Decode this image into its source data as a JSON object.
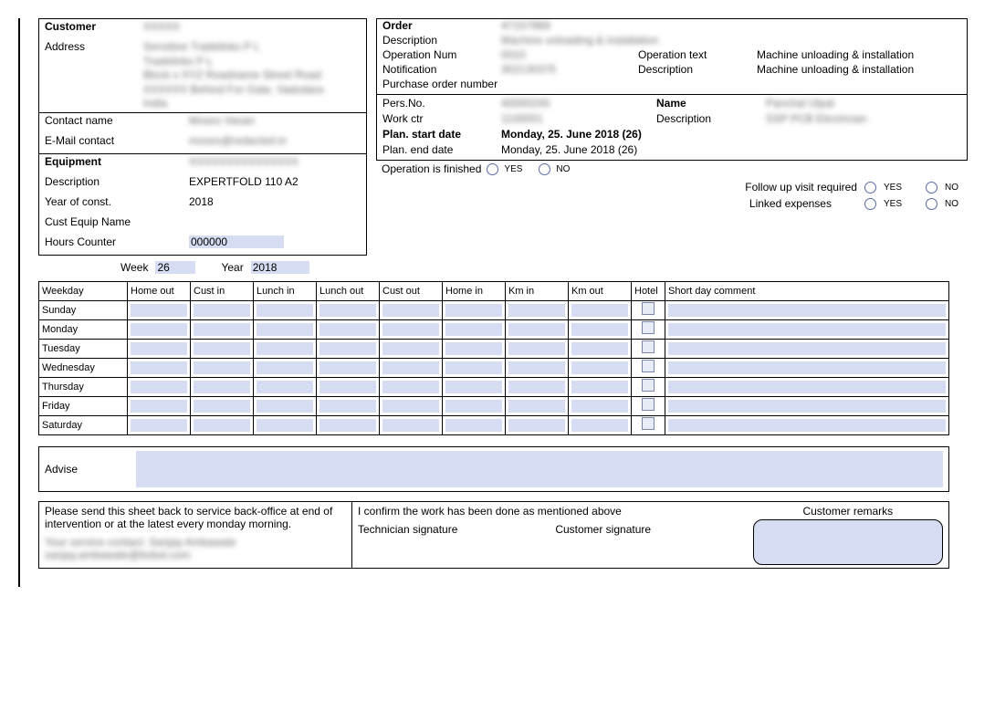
{
  "customer": {
    "label": "Customer",
    "name": "XXXXX",
    "address_label": "Address",
    "address": "Sensitive Tradelinks P L\nTradelinks P L\nBlock x XYZ Roadname Street Road\nXXXXXX Behind For Gate, Vadodara\nIndia",
    "contact_name_label": "Contact name",
    "contact_name": "Moses Vasan",
    "email_label": "E-Mail contact",
    "email": "moses@redacted.in"
  },
  "equipment": {
    "label": "Equipment",
    "value": "XXXXXXXXXXXXXXX",
    "description_label": "Description",
    "description": "EXPERTFOLD 110 A2",
    "year_label": "Year of const.",
    "year": "2018",
    "cust_equip_label": "Cust Equip Name",
    "cust_equip": "",
    "hours_label": "Hours Counter",
    "hours": "000000"
  },
  "week_label": "Week",
  "week_value": "26",
  "year_label": "Year",
  "year_value": "2018",
  "order": {
    "order_label": "Order",
    "order_val": "47157989",
    "description_label": "Description",
    "description_val": "Machine unloading & installation",
    "opnum_label": "Operation Num",
    "opnum_val": "0010",
    "optext_label": "Operation text",
    "optext_val": "Machine unloading & installation",
    "notif_label": "Notification",
    "notif_val": "302130375",
    "desc2_label": "Description",
    "desc2_val": "Machine unloading & installation",
    "po_label": "Purchase order number",
    "po_val": ""
  },
  "pers": {
    "persno_label": "Pers.No.",
    "persno_val": "40000245",
    "name_label": "Name",
    "name_val": "Panchal Utpal",
    "workctr_label": "Work ctr",
    "workctr_val": "1100001",
    "desc_label": "Description",
    "desc_val": "SSP PCB Electrician",
    "planstart_label": "Plan. start date",
    "planstart_val": "Monday, 25. June 2018 (26)",
    "planend_label": "Plan. end date",
    "planend_val": "Monday, 25. June 2018 (26)"
  },
  "options": {
    "op_finished_label": "Operation is finished",
    "followup_label": "Follow up visit required",
    "linked_label": "Linked expenses",
    "yes": "YES",
    "no": "NO"
  },
  "timesheet": {
    "headers": [
      "Weekday",
      "Home out",
      "Cust in",
      "Lunch in",
      "Lunch out",
      "Cust out",
      "Home in",
      "Km in",
      "Km out",
      "Hotel",
      "Short day comment"
    ],
    "rows": [
      "Sunday",
      "Monday",
      "Tuesday",
      "Wednesday",
      "Thursday",
      "Friday",
      "Saturday"
    ]
  },
  "advise_label": "Advise",
  "footer": {
    "instruction": "Please send this sheet back to service back-office at end of intervention or at the latest every monday morning.",
    "contact_line1": "Your service contact: Sanjay Ambawale",
    "contact_line2": "sanjay.ambawale@bobst.com",
    "confirm": "I confirm the work has been done as mentioned above",
    "tech_sig": "Technician signature",
    "cust_sig": "Customer signature",
    "cust_remarks": "Customer remarks"
  }
}
